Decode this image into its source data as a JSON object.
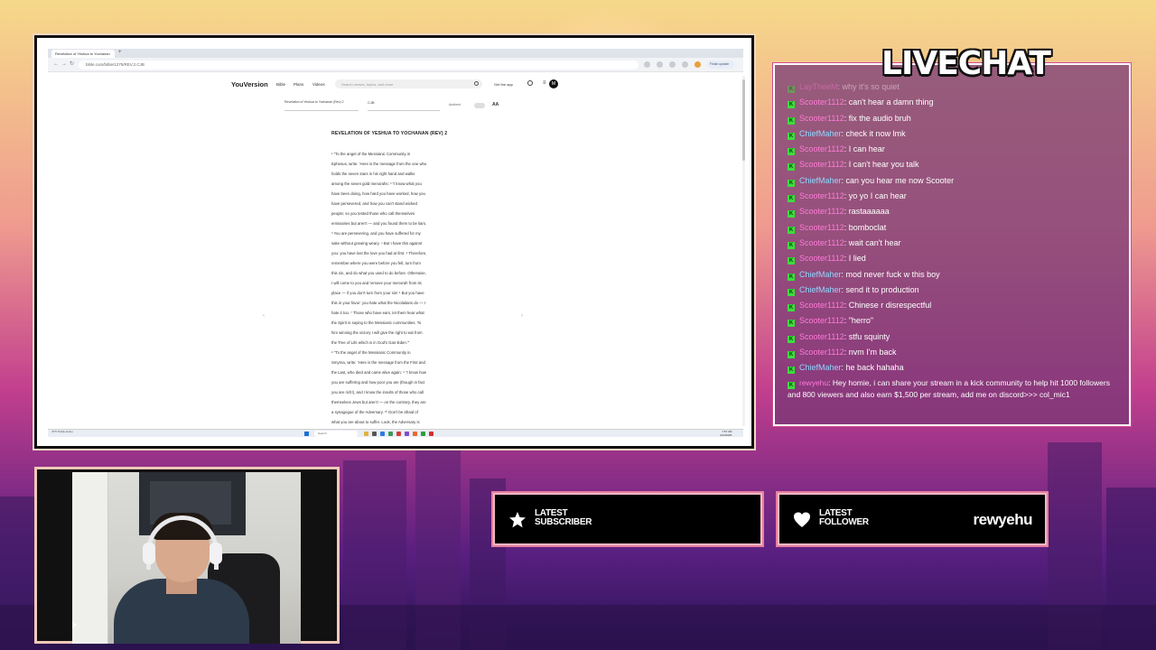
{
  "browser": {
    "tab_title": "Revelation of Yeshua to Yochanan",
    "url": "bible.com/bible/1275/REV.2.CJB",
    "profile_label": "Finish update"
  },
  "youversion": {
    "logo": "YouVersion",
    "nav": [
      "Bible",
      "Plans",
      "Videos"
    ],
    "search_placeholder": "Search verses, topics, and more",
    "get_app": "Get the app",
    "avatar_letter": "M",
    "book_selector": "Revelation of Yeshua to Yochanan (Rev) 2",
    "version_selector": "CJB",
    "audio_label": "Ambient",
    "font_button": "AA",
    "chapter_title": "REVELATION OF YESHUA TO YOCHANAN (REV) 2",
    "passage_lines": [
      "¹ “To the angel of the Messianic Community in",
      "Ephesus, write: ‘Here is the message from the one who",
      "holds the seven stars in his right hand and walks",
      "among the seven gold menorahs: ² “I know what you",
      "have been doing, how hard you have worked, how you",
      "have persevered, and how you can't stand wicked",
      "people; so you tested those who call themselves",
      "emissaries but aren't — and you found them to be liars.",
      "³ You are persevering, and you have suffered for my",
      "sake without growing weary. ⁴ But I have this against",
      "you: you have lost the love you had at first. ⁵ Therefore,",
      "remember where you were before you fell, turn from",
      "this sin, and do what you used to do before. Otherwise,",
      "I will come to you and remove your menorah from its",
      "place — if you don't turn from your sin! ⁶ But you have",
      "this in your favor: you hate what the Nicolaitans do — I",
      "hate it too. ⁷ Those who have ears, let them hear what",
      "the Spirit is saying to the Messianic communities. To",
      "him winning the victory I will give the right to eat from",
      "the Tree of Life which is in God's Gan-Eden.”’",
      "⁸ “To the angel of the Messianic Community in",
      "Smyrna, write: ‘Here is the message from the First and",
      "the Last, who died and came alive again: ⁹ “I know how",
      "you are suffering and how poor you are (though in fact",
      "you are rich!), and I know the insults of those who call",
      "themselves Jews but aren't — on the contrary, they are",
      "a synagogue of the Adversary. ¹⁰ Don't be afraid of",
      "what you are about to suffer. Look, the Adversary is"
    ]
  },
  "taskbar": {
    "weather": "47°F Partly sunny",
    "search_placeholder": "Search",
    "time": "7:57 AM",
    "date": "4/13/2025"
  },
  "chat": {
    "title": "LIVECHAT",
    "messages": [
      {
        "user": "LayTheeM",
        "text": "why it's so quiet",
        "color": "pink",
        "faded": true
      },
      {
        "user": "Scooter1112",
        "text": "can't hear a damn thing",
        "color": "pink"
      },
      {
        "user": "Scooter1112",
        "text": "fix the audio bruh",
        "color": "pink"
      },
      {
        "user": "ChiefMaher",
        "text": "check it now lmk",
        "color": "cyan"
      },
      {
        "user": "Scooter1112",
        "text": "I can hear",
        "color": "pink"
      },
      {
        "user": "Scooter1112",
        "text": "I can't hear you talk",
        "color": "pink"
      },
      {
        "user": "ChiefMaher",
        "text": "can you hear me now Scooter",
        "color": "cyan"
      },
      {
        "user": "Scooter1112",
        "text": "yo yo I can hear",
        "color": "pink"
      },
      {
        "user": "Scooter1112",
        "text": "rastaaaaaa",
        "color": "pink"
      },
      {
        "user": "Scooter1112",
        "text": "bomboclat",
        "color": "pink"
      },
      {
        "user": "Scooter1112",
        "text": "wait can't hear",
        "color": "pink"
      },
      {
        "user": "Scooter1112",
        "text": "I lied",
        "color": "pink"
      },
      {
        "user": "ChiefMaher",
        "text": "mod never fuck w this boy",
        "color": "cyan"
      },
      {
        "user": "ChiefMaher",
        "text": "send it to production",
        "color": "cyan"
      },
      {
        "user": "Scooter1112",
        "text": "Chinese r disrespectful",
        "color": "pink"
      },
      {
        "user": "Scooter1112",
        "text": "\"herro\"",
        "color": "pink"
      },
      {
        "user": "Scooter1112",
        "text": "stfu squinty",
        "color": "pink"
      },
      {
        "user": "Scooter1112",
        "text": "nvm I'm back",
        "color": "pink"
      },
      {
        "user": "ChiefMaher",
        "text": "he back hahaha",
        "color": "cyan"
      }
    ],
    "last_message": {
      "user": "rewyehu",
      "text": "Hey homie, i can share your stream in a kick community to help hit 1000 followers and 800 viewers and also earn $1,500 per stream, add me on discord>>> col_mic1"
    }
  },
  "alerts": {
    "subscriber_label_1": "LATEST",
    "subscriber_label_2": "SUBSCRIBER",
    "subscriber_value": "",
    "follower_label_1": "LATEST",
    "follower_label_2": "FOLLOWER",
    "follower_value": "rewyehu"
  },
  "colors": {
    "chat_badge": "#3ddc3d",
    "user_pink": "#ff7ad8",
    "user_cyan": "#8fd8ff",
    "panel_border": "#f4b6c4"
  }
}
